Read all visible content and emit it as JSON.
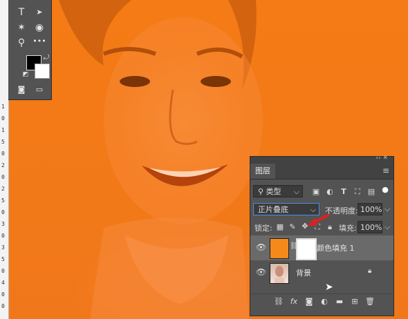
{
  "ruler": {
    "numbers": [
      "1",
      "0",
      "1",
      "5",
      "0",
      "2",
      "0",
      "2",
      "5",
      "0",
      "3",
      "0",
      "3",
      "5",
      "0",
      "4",
      "0",
      "0"
    ]
  },
  "tools": {
    "items": [
      {
        "name": "type-tool-icon",
        "glyph": "T"
      },
      {
        "name": "path-selection-icon",
        "glyph": "▲"
      },
      {
        "name": "puppet-warp-icon",
        "glyph": "✶"
      },
      {
        "name": "3d-rotate-icon",
        "glyph": "◉"
      },
      {
        "name": "zoom-tool-icon",
        "glyph": "⚲"
      },
      {
        "name": "more-tools-icon",
        "glyph": "•••"
      }
    ],
    "foreground_color": "#000000",
    "background_color": "#ffffff"
  },
  "layers_panel": {
    "tab_label": "图层",
    "collapse_glyph": "‹‹ ✕",
    "filter": {
      "label": "类型"
    },
    "blend_mode": "正片叠底",
    "opacity_label": "不透明度:",
    "opacity_value": "100%",
    "lock_label": "锁定:",
    "fill_label": "填充:",
    "fill_value": "100%",
    "layers": [
      {
        "name": "颜色填充 1",
        "thumb_color": "#f58a1b",
        "selected": true
      },
      {
        "name": "背景",
        "selected": false
      }
    ]
  }
}
